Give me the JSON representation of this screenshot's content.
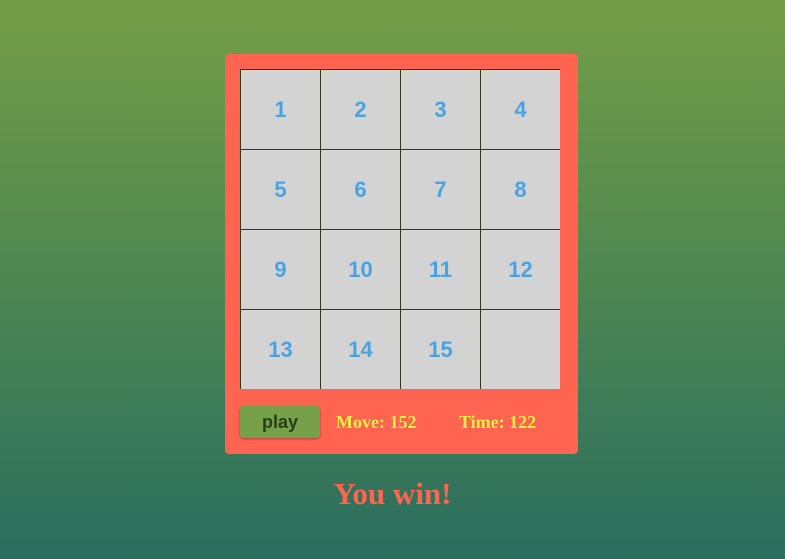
{
  "board": {
    "tiles": [
      "1",
      "2",
      "3",
      "4",
      "5",
      "6",
      "7",
      "8",
      "9",
      "10",
      "11",
      "12",
      "13",
      "14",
      "15",
      ""
    ]
  },
  "controls": {
    "play_label": "play",
    "moves_label": "Move:",
    "moves": 152,
    "time_label": "Time:",
    "time": 122
  },
  "status": {
    "message": "You win!"
  },
  "colors": {
    "panel": "#ff6450",
    "tile": "#d3d3d3",
    "tile_text": "#49a3e2",
    "stat_text": "#ffee44",
    "play_button": "#76a04a"
  }
}
